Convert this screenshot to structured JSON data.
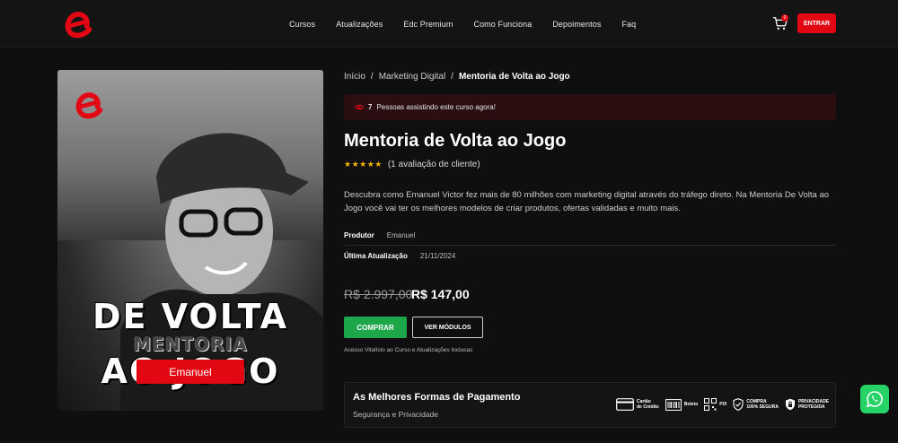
{
  "header": {
    "nav": [
      "Cursos",
      "Atualizações",
      "Edc Premium",
      "Como Funciona",
      "Depoimentos",
      "Faq"
    ],
    "cart_count": "0",
    "login_label": "ENTRAR"
  },
  "cover": {
    "title_line1": "DE VOLTA",
    "title_line2": "MENTORIA",
    "title_line3": "AO JOGO",
    "author_label": "Emanuel"
  },
  "breadcrumb": {
    "home": "Início",
    "category": "Marketing Digital",
    "current": "Mentoria de Volta ao Jogo"
  },
  "watching": {
    "count": "7",
    "text": "Pessoas assistindo este curso agora!"
  },
  "product": {
    "title": "Mentoria de Volta ao Jogo",
    "rating_stars": 5,
    "rating_text": "(1 avaliação de cliente)",
    "description": "Descubra como Emanuel Victor fez mais de 80 milhões com marketing digital através do tráfego direto. Na Mentoria De Volta ao Jogo você vai ter os melhores modelos de criar produtos, ofertas validadas e muito mais.",
    "producer_label": "Produtor",
    "producer_value": "Emanuel",
    "updated_label": "Última Atualização",
    "updated_value": "21/11/2024",
    "old_price": "R$ 2.997,00",
    "new_price": "R$ 147,00",
    "buy_label": "COMPRAR",
    "modules_label": "VER MÓDULOS",
    "access_note": "Acesso Vitalício ao Curso e Atualizações Inclusas"
  },
  "payment": {
    "title": "As Melhores Formas de Pagamento",
    "subtitle": "Segurança e Privacidade",
    "methods": [
      {
        "line1": "Cartão",
        "line2": "de Crédito",
        "icon": "credit-card-icon"
      },
      {
        "line1": "Boleto",
        "line2": "",
        "icon": "barcode-icon"
      },
      {
        "line1": "PIX",
        "line2": "",
        "icon": "qr-code-icon"
      },
      {
        "line1": "COMPRA",
        "line2": "100% SEGURA",
        "icon": "shield-check-icon"
      },
      {
        "line1": "PRIVACIDADE",
        "line2": "PROTEGIDA",
        "icon": "shield-lock-icon"
      }
    ]
  },
  "colors": {
    "accent": "#e30613",
    "buy": "#1ea64a",
    "whatsapp": "#25d366"
  }
}
